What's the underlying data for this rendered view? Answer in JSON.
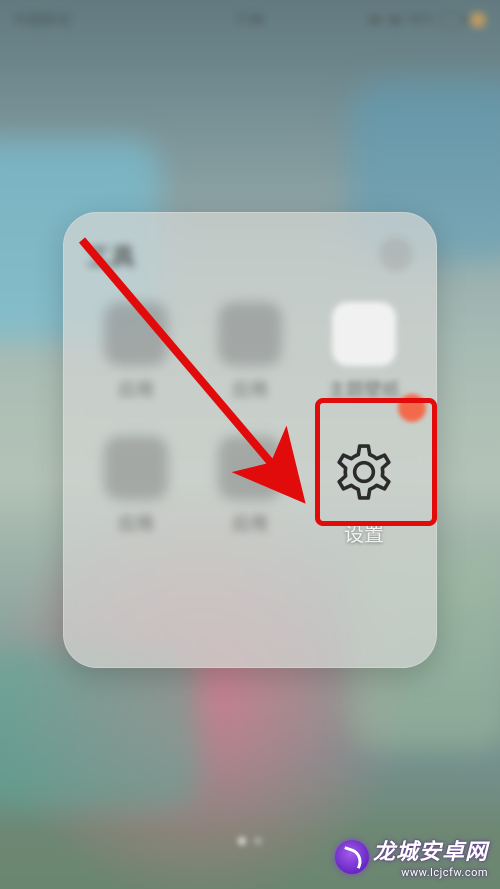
{
  "status": {
    "carrier": "中国移动",
    "time": "7:36",
    "battery": "96%"
  },
  "folder": {
    "title": "工具"
  },
  "apps": [
    {
      "name": "app-1",
      "label": "应用"
    },
    {
      "name": "app-2",
      "label": "应用"
    },
    {
      "name": "app-3",
      "label": "主题壁纸"
    },
    {
      "name": "app-4",
      "label": "应用"
    },
    {
      "name": "app-5",
      "label": "应用"
    },
    {
      "name": "settings",
      "label": "设置"
    }
  ],
  "annotation": {
    "highlight_target": "settings",
    "arrow_color": "#e10b0b"
  },
  "watermark": {
    "title": "龙城安卓网",
    "url": "www.lcjcfw.com"
  }
}
